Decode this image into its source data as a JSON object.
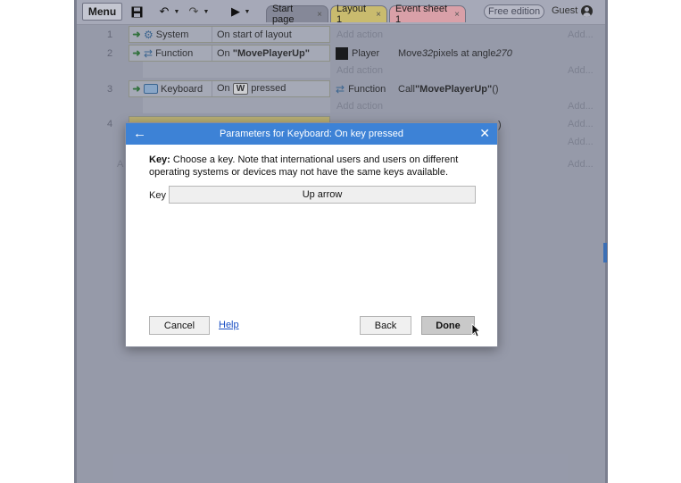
{
  "toolbar": {
    "menu_label": "Menu",
    "tabs": [
      {
        "label": "Start page"
      },
      {
        "label": "Layout 1"
      },
      {
        "label": "Event sheet 1"
      }
    ],
    "free_edition": "Free edition",
    "guest": "Guest"
  },
  "events": [
    {
      "num": "1",
      "object": "System",
      "condition": "On start of layout",
      "action_object": "",
      "action": "",
      "add_action": "Add action",
      "add": "Add..."
    },
    {
      "num": "2",
      "object": "Function",
      "condition_prefix": "On ",
      "condition_bold": "\"MovePlayerUp\"",
      "action_object": "Player",
      "action_prefix": "Move ",
      "action_num1": "32",
      "action_mid": " pixels at angle ",
      "action_num2": "270",
      "add_action": "Add action",
      "add": "Add..."
    },
    {
      "num": "3",
      "object": "Keyboard",
      "condition_prefix": "On ",
      "key": "W",
      "condition_suffix": " pressed",
      "action_object": "Function",
      "action_prefix": "Call ",
      "action_bold": "\"MovePlayerUp\"",
      "action_suffix": " ()",
      "add_action": "Add action",
      "add": "Add..."
    },
    {
      "num": "4",
      "add": "Add...",
      "partial_action_suffix": ")"
    }
  ],
  "row4_add2": "Add...",
  "left_partial": "A",
  "dialog": {
    "title": "Parameters for Keyboard: On key pressed",
    "desc_bold": "Key:",
    "desc_text": " Choose a key. Note that international users and users on different operating systems or devices may not have the same keys available.",
    "key_label": "Key",
    "key_value": "Up arrow",
    "cancel": "Cancel",
    "help": "Help",
    "back": "Back",
    "done": "Done"
  }
}
